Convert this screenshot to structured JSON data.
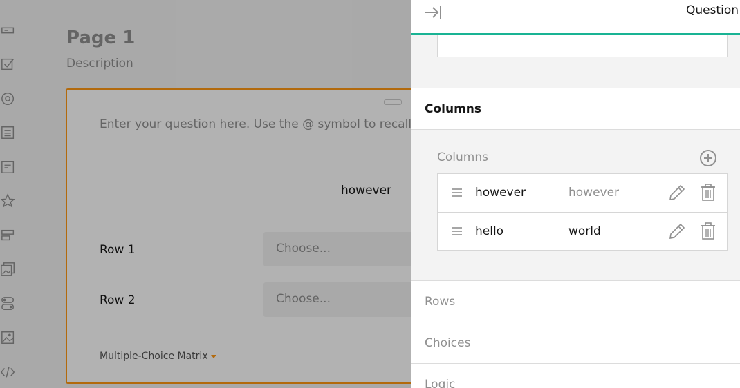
{
  "toolbox": {
    "icons": [
      "single-input-icon",
      "checkbox-icon",
      "radiogroup-icon",
      "comment-icon",
      "multiple-text-icon",
      "rating-icon",
      "ranking-icon",
      "image-picker-icon",
      "boolean-icon",
      "image-icon",
      "html-icon"
    ]
  },
  "designer": {
    "page_title": "Page 1",
    "page_description": "Description",
    "question": {
      "title": "Enter your question here. Use the @ symbol to recall",
      "column_header": "however",
      "rows": [
        {
          "label": "Row 1",
          "placeholder": "Choose..."
        },
        {
          "label": "Row 2",
          "placeholder": "Choose..."
        }
      ],
      "type_label": "Multiple-Choice Matrix"
    }
  },
  "property_panel": {
    "title": "Question",
    "sections": {
      "columns_header": "Columns",
      "columns_label": "Columns",
      "rows": "Rows",
      "choices": "Choices",
      "logic": "Logic"
    },
    "columns": [
      {
        "value": "however",
        "text": "however",
        "text_is_placeholder": true
      },
      {
        "value": "hello",
        "text": "world",
        "text_is_placeholder": false
      }
    ],
    "accent_color": "#19b394",
    "selection_color": "#ff9814"
  }
}
